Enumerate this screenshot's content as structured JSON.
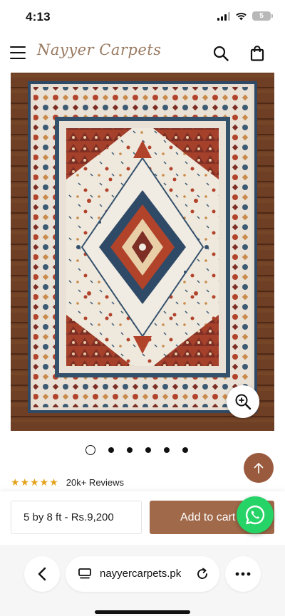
{
  "status": {
    "time": "4:13",
    "battery": "5"
  },
  "header": {
    "logo": "Nayyer Carpets"
  },
  "product": {
    "image_name": "rug-photo",
    "rating_stars": "★★★★★",
    "rating_value": 5,
    "reviews": "20k+ Reviews",
    "variant": "5 by 8 ft - Rs.9,200",
    "add_to_cart": "Add to cart",
    "carousel": {
      "total": 6,
      "active": 1
    }
  },
  "browser": {
    "url": "nayyercarpets.pk"
  },
  "colors": {
    "accent": "#a0694a",
    "back_to_top": "#9a5a3e",
    "whatsapp": "#25d366",
    "stars": "#e3a31c",
    "logo": "#9a7b62"
  },
  "icons": [
    "menu-icon",
    "search-icon",
    "shopping-bag-icon",
    "zoom-in-icon",
    "arrow-up-icon",
    "whatsapp-icon",
    "chevron-left-icon",
    "tab-overview-icon",
    "reload-icon",
    "more-dots-icon"
  ]
}
